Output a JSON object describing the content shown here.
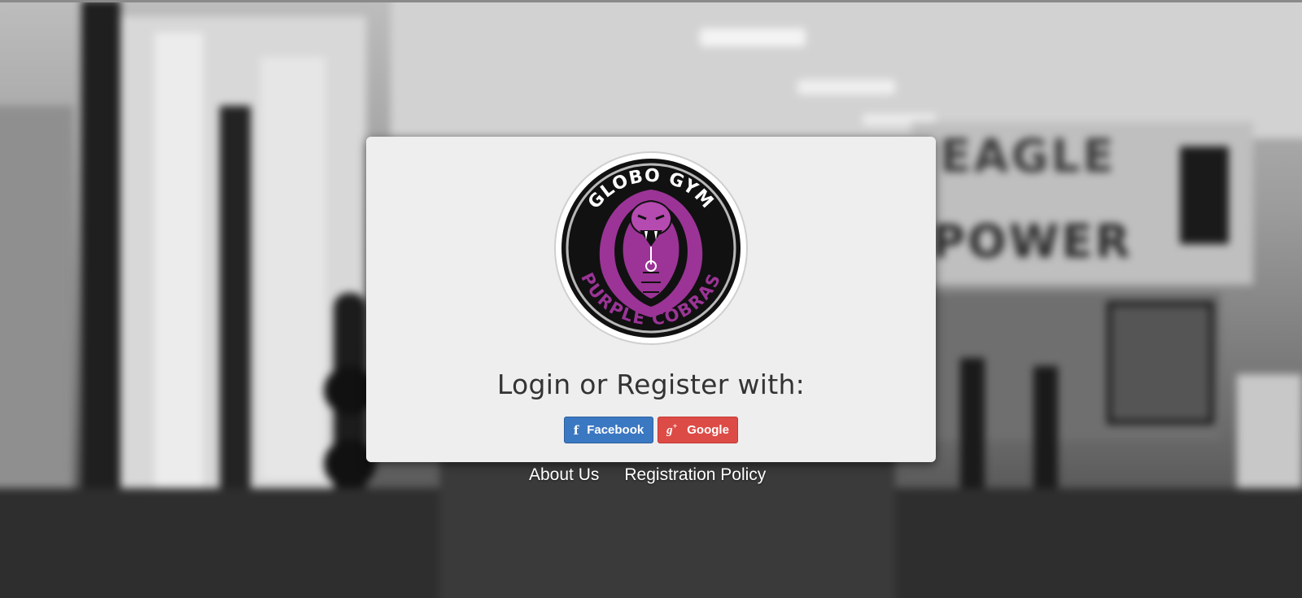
{
  "background": {
    "wall_sign_line1": "EAGLE",
    "wall_sign_line2": "POWER"
  },
  "logo": {
    "top_text": "GLOBO GYM",
    "bottom_text": "PURPLE COBRAS",
    "accent_color": "#9b3496"
  },
  "login": {
    "heading": "Login or Register with:",
    "facebook": {
      "icon": "f",
      "label": "Facebook",
      "color": "#3b78c2"
    },
    "google": {
      "icon": "g",
      "icon_sup": "+",
      "label": "Google",
      "color": "#dd4b46"
    }
  },
  "footer": {
    "about_label": "About Us",
    "policy_label": "Registration Policy"
  }
}
